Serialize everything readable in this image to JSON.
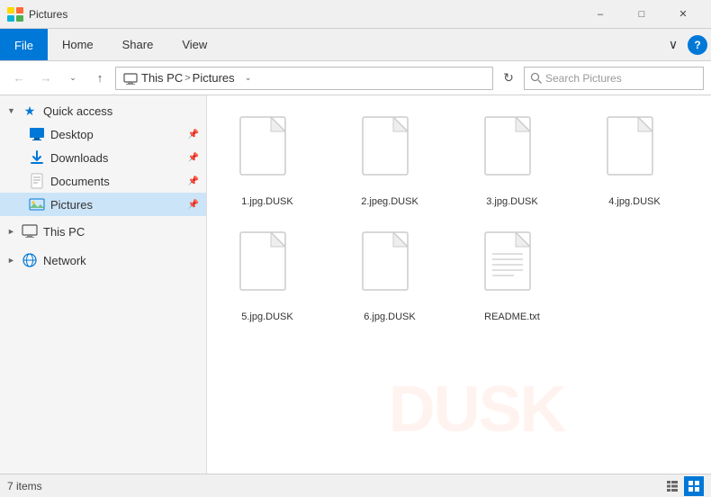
{
  "titleBar": {
    "title": "Pictures",
    "minimizeLabel": "–",
    "maximizeLabel": "□",
    "closeLabel": "✕"
  },
  "ribbon": {
    "tabs": [
      "File",
      "Home",
      "Share",
      "View"
    ],
    "activeTab": "File",
    "helpIcon": "?",
    "chevronIcon": "∨"
  },
  "addressBar": {
    "backLabel": "←",
    "forwardLabel": "→",
    "downLabel": "∨",
    "upLabel": "↑",
    "breadcrumbs": [
      "This PC",
      "Pictures"
    ],
    "separatorLabel": ">",
    "refreshLabel": "⟳",
    "searchPlaceholder": "Search Pictures"
  },
  "sidebar": {
    "quickAccess": {
      "label": "Quick access",
      "expanded": true,
      "items": [
        {
          "label": "Desktop",
          "pinned": true,
          "type": "desktop"
        },
        {
          "label": "Downloads",
          "pinned": true,
          "type": "downloads"
        },
        {
          "label": "Documents",
          "pinned": true,
          "type": "documents"
        },
        {
          "label": "Pictures",
          "pinned": true,
          "type": "pictures",
          "active": true
        }
      ]
    },
    "thisPC": {
      "label": "This PC",
      "expanded": false
    },
    "network": {
      "label": "Network",
      "expanded": false
    }
  },
  "files": [
    {
      "name": "1.jpg.DUSK",
      "type": "generic"
    },
    {
      "name": "2.jpeg.DUSK",
      "type": "generic"
    },
    {
      "name": "3.jpg.DUSK",
      "type": "generic"
    },
    {
      "name": "4.jpg.DUSK",
      "type": "generic"
    },
    {
      "name": "5.jpg.DUSK",
      "type": "generic"
    },
    {
      "name": "6.jpg.DUSK",
      "type": "generic"
    },
    {
      "name": "README.txt",
      "type": "text"
    }
  ],
  "statusBar": {
    "itemCount": "7 items"
  }
}
